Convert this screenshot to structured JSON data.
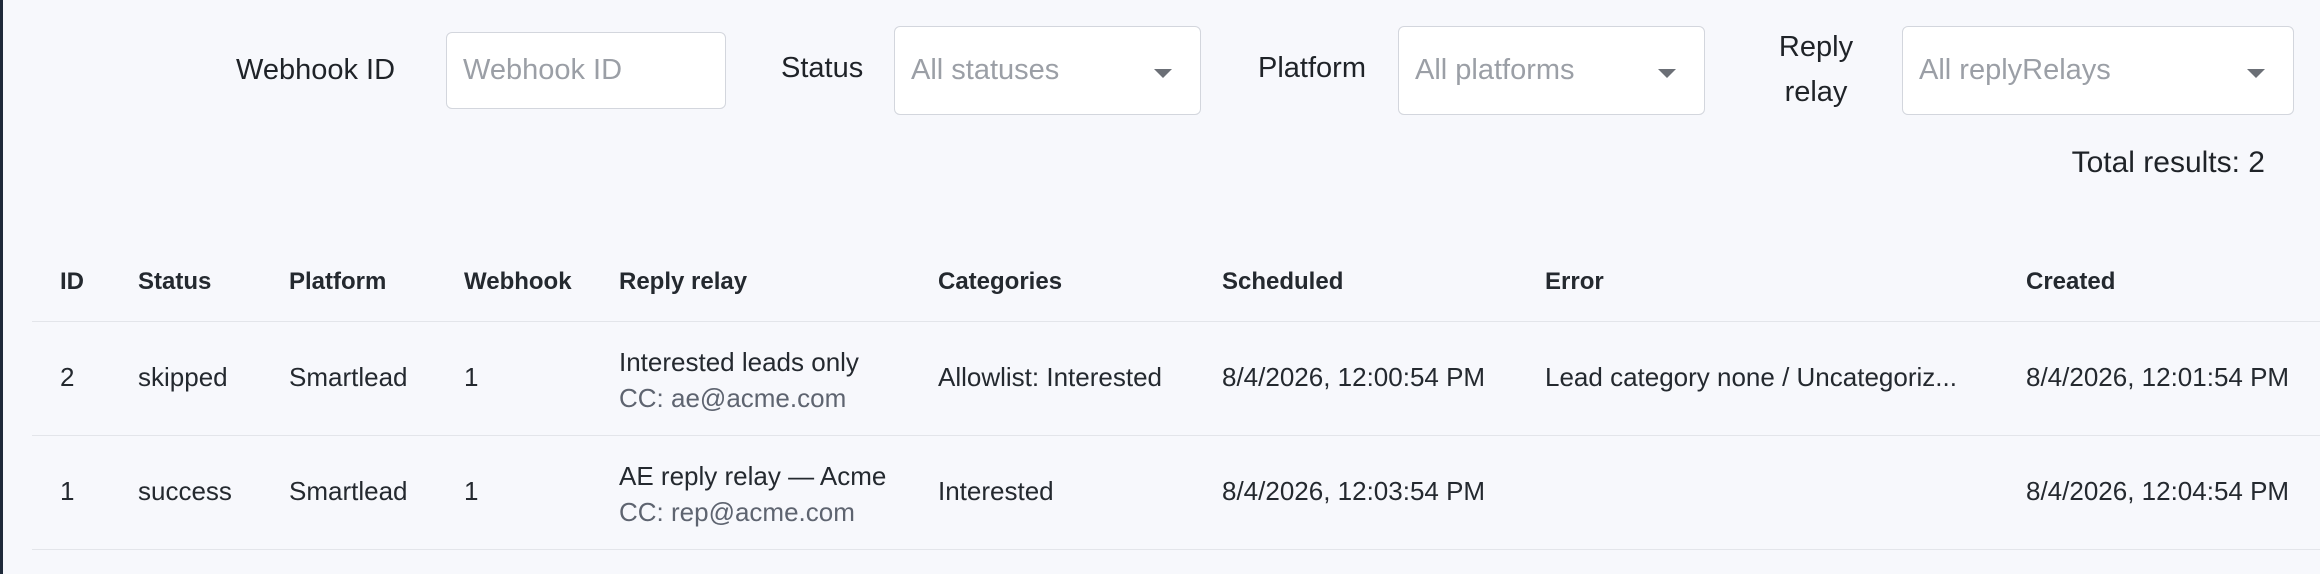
{
  "filters": {
    "webhook_id": {
      "label": "Webhook ID",
      "placeholder": "Webhook ID",
      "value": ""
    },
    "status": {
      "label": "Status",
      "placeholder": "All statuses"
    },
    "platform": {
      "label": "Platform",
      "placeholder": "All platforms"
    },
    "reply_relay": {
      "label_line1": "Reply",
      "label_line2": "relay",
      "placeholder": "All replyRelays"
    }
  },
  "total_results": "Total results: 2",
  "table": {
    "headers": {
      "id": "ID",
      "status": "Status",
      "platform": "Platform",
      "webhook": "Webhook",
      "reply_relay": "Reply relay",
      "categories": "Categories",
      "scheduled": "Scheduled",
      "error": "Error",
      "created": "Created"
    },
    "rows": [
      {
        "id": "2",
        "status": "skipped",
        "platform": "Smartlead",
        "webhook": "1",
        "relay_name": "Interested leads only",
        "relay_cc": "CC: ae@acme.com",
        "categories": "Allowlist: Interested",
        "scheduled": "8/4/2026, 12:00:54 PM",
        "error": "Lead category none / Uncategoriz...",
        "created": "8/4/2026, 12:01:54 PM"
      },
      {
        "id": "1",
        "status": "success",
        "platform": "Smartlead",
        "webhook": "1",
        "relay_name": "AE reply relay — Acme",
        "relay_cc": "CC: rep@acme.com",
        "categories": "Interested",
        "scheduled": "8/4/2026, 12:03:54 PM",
        "error": "",
        "created": "8/4/2026, 12:04:54 PM"
      }
    ]
  }
}
